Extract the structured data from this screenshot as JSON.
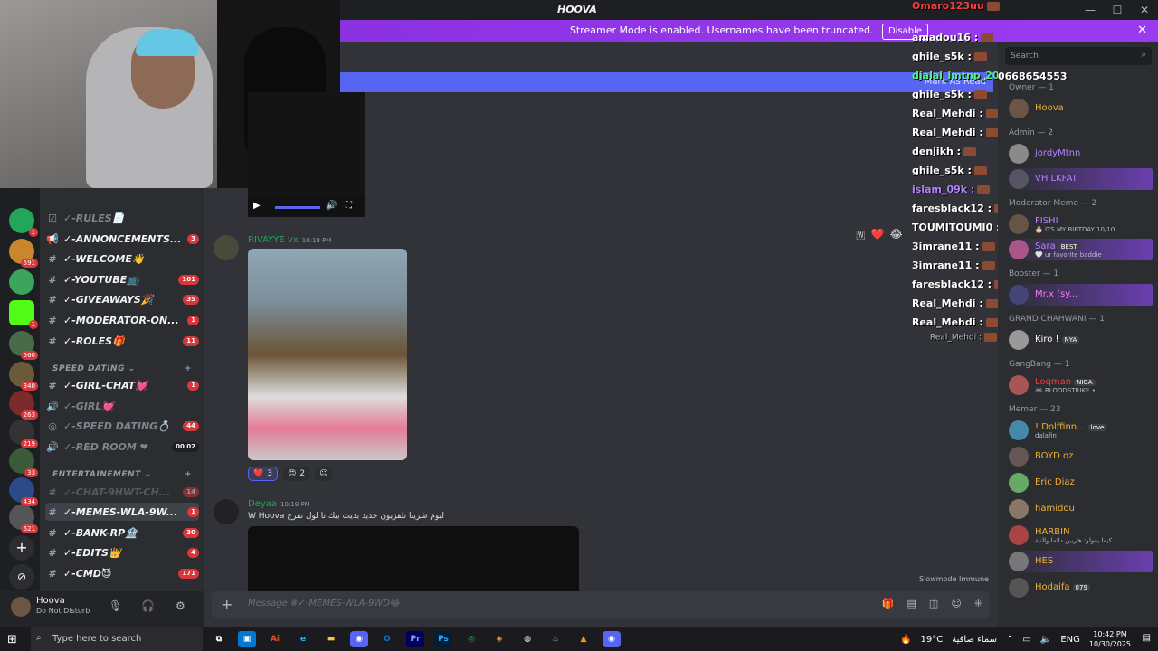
{
  "titlebar": {
    "title": "HOOVA"
  },
  "banner": {
    "text": "Streamer Mode is enabled. Usernames have been truncated.",
    "button": "Disable"
  },
  "markbar": {
    "text": "Mark As Read"
  },
  "rail": {
    "badges": [
      "1",
      "1",
      "591",
      "1",
      "560",
      "340",
      "263",
      "219",
      "33",
      "434",
      "621"
    ]
  },
  "channels": {
    "items": [
      {
        "icon": "☑",
        "name": "✓-RULES📄",
        "count": "",
        "state": "muted"
      },
      {
        "icon": "📢",
        "name": "✓-ANNONCEMENTS...",
        "count": "3",
        "state": ""
      },
      {
        "icon": "#",
        "name": "✓-WELCOME👋",
        "count": "",
        "state": ""
      },
      {
        "icon": "#",
        "name": "✓-YOUTUBE📺",
        "count": "101",
        "state": ""
      },
      {
        "icon": "#",
        "name": "✓-GIVEAWAYS🎉",
        "count": "35",
        "state": ""
      },
      {
        "icon": "#",
        "name": "✓-MODERATOR-ON...",
        "count": "1",
        "state": ""
      },
      {
        "icon": "#",
        "name": "✓-ROLES🎁",
        "count": "11",
        "state": ""
      }
    ],
    "cat1": "SPEED DATING",
    "dating": [
      {
        "icon": "#",
        "name": "✓-GIRL-CHAT💓",
        "count": "1",
        "state": ""
      },
      {
        "icon": "🔊",
        "name": "✓-GIRL💓",
        "count": "",
        "state": "muted"
      },
      {
        "icon": "◎",
        "name": "✓-SPEED DATING💍",
        "count": "44",
        "state": "muted"
      },
      {
        "icon": "🔊",
        "name": "✓-RED ROOM ❤",
        "count": "00 02",
        "state": "muted"
      }
    ],
    "cat2": "ENTERTAINEMENT",
    "ent": [
      {
        "icon": "#",
        "name": "✓-CHAT-9HWT-CH...",
        "count": "14",
        "state": "muted"
      },
      {
        "icon": "#",
        "name": "✓-MEMES-WLA-9W...",
        "count": "1",
        "state": "active"
      },
      {
        "icon": "#",
        "name": "✓-BANK-RP🏦",
        "count": "30",
        "state": ""
      },
      {
        "icon": "#",
        "name": "✓-EDITS👑",
        "count": "4",
        "state": ""
      },
      {
        "icon": "#",
        "name": "✓-CMD😈",
        "count": "171",
        "state": ""
      }
    ]
  },
  "user": {
    "name": "Hoova",
    "status": "Do Not Disturb"
  },
  "chat": {
    "msg1": {
      "author": "RIVAYYE vx",
      "time": "10:18 PM",
      "color": "#23a55a"
    },
    "reactions": [
      {
        "emoji": "❤️",
        "count": "3"
      },
      {
        "emoji": "😍",
        "count": "2"
      }
    ],
    "msg2": {
      "author": "Deyaa",
      "time": "10:19 PM",
      "text": "W Hoova ليوم شريتا تلفزيون جديد بديت بيك تا لول تفرج",
      "color": "#23a55a"
    },
    "slowmode": "Slowmode Immune",
    "placeholder": "Message #✓-MEMES-WLA-9WD😂"
  },
  "overlay": [
    {
      "text": "Omaro123uu",
      "color": "#f23f43"
    },
    {
      "text": "amadou16 :",
      "color": "#ffffff"
    },
    {
      "text": "ghile_s5k :",
      "color": "#ffffff"
    },
    {
      "text": "djalal_lmtnp_200 :",
      "color": "#57f287"
    },
    {
      "text": "ghile_s5k :",
      "color": "#ffffff"
    },
    {
      "text": "Real_Mehdi :",
      "color": "#ffffff"
    },
    {
      "text": "Real_Mehdi :",
      "color": "#ffffff"
    },
    {
      "text": "denjikh :",
      "color": "#ffffff"
    },
    {
      "text": "ghile_s5k :",
      "color": "#ffffff"
    },
    {
      "text": "islam_09k :",
      "color": "#b383ff"
    },
    {
      "text": "faresblack12 :",
      "color": "#ffffff"
    },
    {
      "text": "TOUMITOUMI0 :",
      "color": "#ffffff"
    },
    {
      "text": "3imrane11 :",
      "color": "#ffffff"
    },
    {
      "text": "3imrane11 :",
      "color": "#ffffff"
    },
    {
      "text": "faresblack12 :",
      "color": "#ffffff"
    },
    {
      "text": "Real_Mehdi :",
      "color": "#ffffff"
    },
    {
      "text": "Real_Mehdi :",
      "color": "#ffffff"
    },
    {
      "text": "Real_Mehdi :",
      "color": "#b5bac1"
    }
  ],
  "phone": "0668654553",
  "members": {
    "search": "Search",
    "groups": [
      {
        "title": "Owner — 1",
        "list": [
          {
            "name": "Hoova",
            "sub": "",
            "color": "#f0b232"
          }
        ]
      },
      {
        "title": "Admin — 2",
        "list": [
          {
            "name": "jordyMtnn",
            "sub": "",
            "color": "#b383ff"
          },
          {
            "name": "VH LKFAT",
            "sub": "",
            "color": "#b383ff"
          }
        ]
      },
      {
        "title": "Moderator Meme — 2",
        "list": [
          {
            "name": "FISHI",
            "sub": "🎂 ITS MY BIRTDAY 10/10",
            "color": "#b383ff"
          },
          {
            "name": "Sara",
            "sub": "🤍 ur favorite baddie",
            "color": "#b383ff"
          }
        ]
      },
      {
        "title": "Booster — 1",
        "list": [
          {
            "name": "Mr.x (sy...",
            "sub": "",
            "color": "#ff73fa"
          }
        ]
      },
      {
        "title": "GRAND CHAHWANI — 1",
        "list": [
          {
            "name": "Kiro !",
            "sub": "",
            "color": "#ffffff"
          }
        ]
      },
      {
        "title": "GangBang — 1",
        "list": [
          {
            "name": "Loqman",
            "sub": "🎮 BLOODSTRIKE •",
            "color": "#f23f43"
          }
        ]
      },
      {
        "title": "Memer — 23",
        "list": [
          {
            "name": "! Dolffinn...",
            "sub": "dalafin",
            "color": "#f0b232"
          },
          {
            "name": "BOYD oz",
            "sub": "",
            "color": "#f0b232"
          },
          {
            "name": "Eric Diaz",
            "sub": "",
            "color": "#f0b232"
          },
          {
            "name": "hamidou",
            "sub": "",
            "color": "#f0b232"
          },
          {
            "name": "HARBIN",
            "sub": "كيما يقولو: هاربين دائما والنية",
            "color": "#f0b232"
          },
          {
            "name": "HES",
            "sub": "",
            "color": "#f0b232"
          },
          {
            "name": "Hodaifa",
            "sub": "",
            "color": "#f0b232"
          }
        ]
      }
    ],
    "tags": {
      "sara": "BEST",
      "kiro": "NYA",
      "loqman": "NIGA",
      "dolffinn": "love",
      "hodaifa": "079"
    }
  },
  "taskbar": {
    "search": "Type here to search",
    "weather": "19°C",
    "weather_text": "سماء صافية",
    "lang": "ENG",
    "time": "10:42 PM",
    "date": "10/30/2025"
  }
}
